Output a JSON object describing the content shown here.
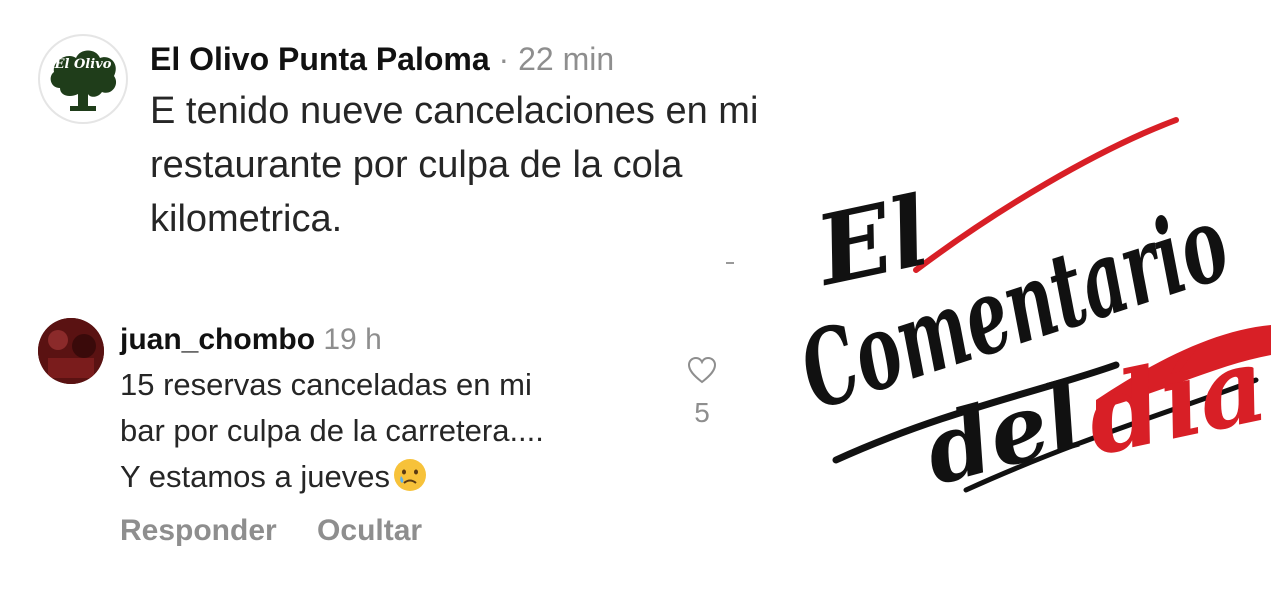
{
  "comment1": {
    "username": "El Olivo Punta Paloma",
    "separator": "·",
    "time": "22 min",
    "text": "E tenido nueve cancelaciones en mi restaurante por culpa de la cola kilometrica.",
    "avatar": {
      "logo_text": "El Olivo",
      "icon": "olive-tree-logo"
    }
  },
  "comment2": {
    "username": "juan_chombo",
    "time": "19 h",
    "text_line1": "15 reservas canceladas en mi",
    "text_line2": "bar por culpa de la carretera....",
    "text_line3": "Y estamos a jueves",
    "emoji": "crying-face-icon",
    "like_count": "5",
    "reply_label": "Responder",
    "hide_label": "Ocultar"
  },
  "overlay": {
    "line1": "El",
    "line2": "Comentario",
    "line3_a": "del",
    "line3_b": "día",
    "accent_color": "#d81f26"
  },
  "colors": {
    "muted": "#8e8e8e",
    "text": "#262626"
  }
}
